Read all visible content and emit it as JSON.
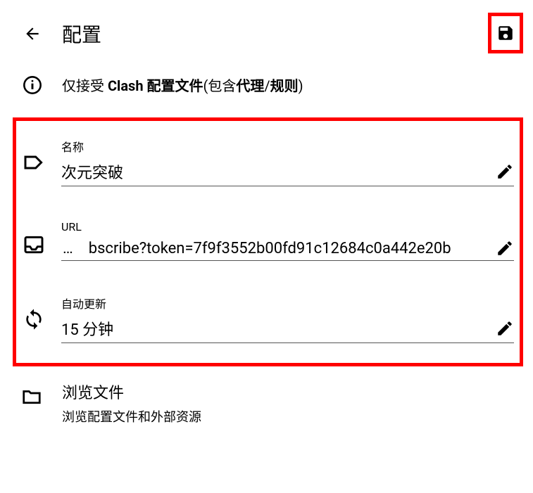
{
  "header": {
    "title": "配置"
  },
  "info": {
    "prefix": "仅接受 ",
    "bold1": "Clash 配置文件",
    "mid": "(包含",
    "bold2": "代理",
    "slash": "/",
    "bold3": "规则",
    "suffix": ")"
  },
  "fields": {
    "name": {
      "label": "名称",
      "value": "次元突破"
    },
    "url": {
      "label": "URL",
      "ellipsis": "…",
      "value": "bscribe?token=7f9f3552b00fd91c12684c0a442e20b"
    },
    "autoUpdate": {
      "label": "自动更新",
      "value": "15 分钟"
    }
  },
  "browse": {
    "title": "浏览文件",
    "subtitle": "浏览配置文件和外部资源"
  }
}
